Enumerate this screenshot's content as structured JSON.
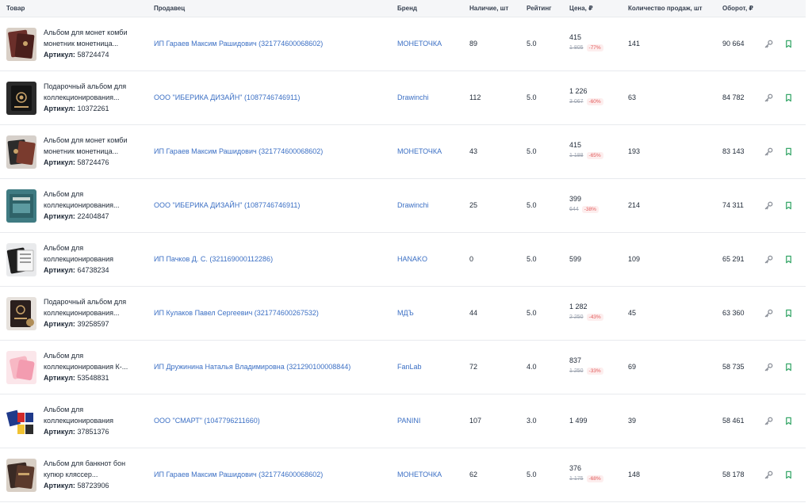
{
  "headers": {
    "product": "Товар",
    "seller": "Продавец",
    "brand": "Бренд",
    "stock": "Наличие, шт",
    "rating": "Рейтинг",
    "price": "Цена, ₽",
    "sales": "Количество продаж, шт",
    "turnover": "Оборот, ₽"
  },
  "article_label": "Артикул:",
  "colors": {
    "link": "#3b6fc4",
    "discount": "#e25b5b",
    "bookmark": "#3aa86b"
  },
  "rows": [
    {
      "name": "Альбом для монет комби монетник монетница...",
      "article": "58724474",
      "seller": "ИП Гараев Максим Рашидович (321774600068602)",
      "brand": "МОНЕТОЧКА",
      "stock": "89",
      "rating": "5.0",
      "price": "415",
      "old_price": "1 805",
      "discount": "-77%",
      "sales": "141",
      "turnover": "90 664",
      "thumb": "brown-album"
    },
    {
      "name": "Подарочный альбом для коллекционирования...",
      "article": "10372261",
      "seller": "ООО \"ИБЕРИКА ДИЗАЙН\" (1087746746911)",
      "brand": "Drawinchi",
      "stock": "112",
      "rating": "5.0",
      "price": "1 226",
      "old_price": "3 067",
      "discount": "-60%",
      "sales": "63",
      "turnover": "84 782",
      "thumb": "dark-gift-album"
    },
    {
      "name": "Альбом для монет комби монетник монетница...",
      "article": "58724476",
      "seller": "ИП Гараев Максим Рашидович (321774600068602)",
      "brand": "МОНЕТОЧКА",
      "stock": "43",
      "rating": "5.0",
      "price": "415",
      "old_price": "1 188",
      "discount": "-65%",
      "sales": "193",
      "turnover": "83 143",
      "thumb": "black-album"
    },
    {
      "name": "Альбом для коллекционирования...",
      "article": "22404847",
      "seller": "ООО \"ИБЕРИКА ДИЗАЙН\" (1087746746911)",
      "brand": "Drawinchi",
      "stock": "25",
      "rating": "5.0",
      "price": "399",
      "old_price": "644",
      "discount": "-38%",
      "sales": "214",
      "turnover": "74 311",
      "thumb": "teal-album"
    },
    {
      "name": "Альбом для коллекционирования",
      "article": "64738234",
      "seller": "ИП Пачков Д. С. (321169000112286)",
      "brand": "HANAKO",
      "stock": "0",
      "rating": "5.0",
      "price": "599",
      "old_price": "",
      "discount": "",
      "sales": "109",
      "turnover": "65 291",
      "thumb": "binder-album"
    },
    {
      "name": "Подарочный альбом для коллекционирования...",
      "article": "39258597",
      "seller": "ИП Кулаков Павел Сергеевич (321774600267532)",
      "brand": "МДЪ",
      "stock": "44",
      "rating": "5.0",
      "price": "1 282",
      "old_price": "2 250",
      "discount": "-43%",
      "sales": "45",
      "turnover": "63 360",
      "thumb": "coin-album"
    },
    {
      "name": "Альбом для коллекционирования К-...",
      "article": "53548831",
      "seller": "ИП Дружинина Наталья Владимировна (321290100008844)",
      "brand": "FanLab",
      "stock": "72",
      "rating": "4.0",
      "price": "837",
      "old_price": "1 250",
      "discount": "-33%",
      "sales": "69",
      "turnover": "58 735",
      "thumb": "pink-album"
    },
    {
      "name": "Альбом для коллекционирования",
      "article": "37851376",
      "seller": "ООО \"СМАРТ\" (1047796211660)",
      "brand": "PANINI",
      "stock": "107",
      "rating": "3.0",
      "price": "1 499",
      "old_price": "",
      "discount": "",
      "sales": "39",
      "turnover": "58 461",
      "thumb": "panini-album"
    },
    {
      "name": "Альбом для банкнот бон купюр кляссер...",
      "article": "58723906",
      "seller": "ИП Гараев Максим Рашидович (321774600068602)",
      "brand": "МОНЕТОЧКА",
      "stock": "62",
      "rating": "5.0",
      "price": "376",
      "old_price": "1 175",
      "discount": "-68%",
      "sales": "148",
      "turnover": "58 178",
      "thumb": "brown-banknote-album"
    }
  ]
}
